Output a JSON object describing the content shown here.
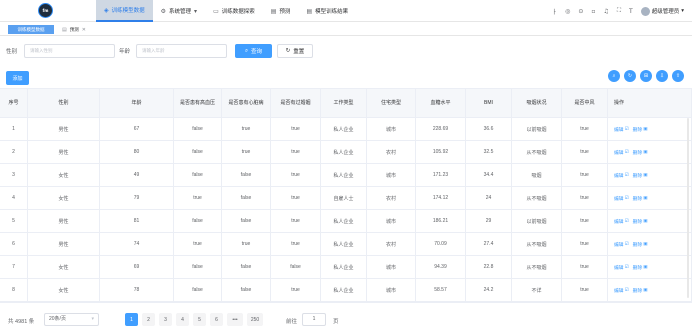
{
  "logo": {
    "text": "fm"
  },
  "topnav": [
    {
      "label": "训练模型数据",
      "icon": "layers-icon",
      "glyph": "◈",
      "active": true
    },
    {
      "label": "系统管理",
      "icon": "gear-icon",
      "glyph": "⚙",
      "caret": "▾"
    },
    {
      "label": "训练数据探索",
      "icon": "monitor-icon",
      "glyph": "▭"
    },
    {
      "label": "预测",
      "icon": "document-icon",
      "glyph": "▤"
    },
    {
      "label": "模型训练结果",
      "icon": "document-icon",
      "glyph": "▤"
    }
  ],
  "header_tools": [
    "translate-icon",
    "github-icon",
    "help-icon",
    "screenshot-icon",
    "bell-icon",
    "fullscreen-icon",
    "font-size-icon"
  ],
  "header_tool_glyphs": [
    "ㅏ",
    "◎",
    "⊙",
    "▫",
    "♫",
    "⛶",
    "T"
  ],
  "user": {
    "name": "超级管理员",
    "caret": "▾"
  },
  "tags": [
    {
      "label": "训练模型数据"
    },
    {
      "label": "预测",
      "icon_glyph": "▤",
      "close": "✕"
    }
  ],
  "search": {
    "gender_label": "性别",
    "gender_placeholder": "请输入性别",
    "age_label": "年龄",
    "age_placeholder": "请输入年龄",
    "query_label": "查询",
    "query_glyph": "⌕",
    "reset_label": "重置",
    "reset_glyph": "↻"
  },
  "add_label": "添加",
  "toolbar_glyphs": [
    "⌕",
    "↻",
    "⊞",
    "⇩",
    "⇧"
  ],
  "columns": [
    "序号",
    "性别",
    "年龄",
    "是否患有高血压",
    "是否患有心脏病",
    "是否有过婚姻",
    "工作类型",
    "住宅类型",
    "血糖水平",
    "BMI",
    "吸烟状况",
    "是否中风",
    "操作"
  ],
  "rows": [
    [
      "1",
      "男性",
      "67",
      "false",
      "true",
      "true",
      "私人企业",
      "城市",
      "228.69",
      "36.6",
      "以前吸烟",
      "true"
    ],
    [
      "2",
      "男性",
      "80",
      "false",
      "true",
      "true",
      "私人企业",
      "农村",
      "105.92",
      "32.5",
      "从不吸烟",
      "true"
    ],
    [
      "3",
      "女性",
      "49",
      "false",
      "false",
      "true",
      "私人企业",
      "城市",
      "171.23",
      "34.4",
      "吸烟",
      "true"
    ],
    [
      "4",
      "女性",
      "79",
      "true",
      "false",
      "true",
      "自雇人士",
      "农村",
      "174.12",
      "24",
      "从不吸烟",
      "true"
    ],
    [
      "5",
      "男性",
      "81",
      "false",
      "false",
      "true",
      "私人企业",
      "城市",
      "186.21",
      "29",
      "以前吸烟",
      "true"
    ],
    [
      "6",
      "男性",
      "74",
      "true",
      "true",
      "true",
      "私人企业",
      "农村",
      "70.09",
      "27.4",
      "从不吸烟",
      "true"
    ],
    [
      "7",
      "女性",
      "69",
      "false",
      "false",
      "false",
      "私人企业",
      "城市",
      "94.39",
      "22.8",
      "从不吸烟",
      "true"
    ],
    [
      "8",
      "女性",
      "78",
      "false",
      "false",
      "true",
      "私人企业",
      "城市",
      "58.57",
      "24.2",
      "不详",
      "true"
    ]
  ],
  "row_actions": {
    "edit": "编辑",
    "edit_glyph": "☑",
    "delete": "删除",
    "delete_glyph": "▣"
  },
  "pagination": {
    "total": "共 4981 条",
    "page_size": "20条/页",
    "chev": "▾",
    "pages": [
      "1",
      "2",
      "3",
      "4",
      "5",
      "6",
      "•••",
      "250"
    ],
    "current": "1",
    "goto_label": "前往",
    "goto_value": "1",
    "unit": "页"
  }
}
